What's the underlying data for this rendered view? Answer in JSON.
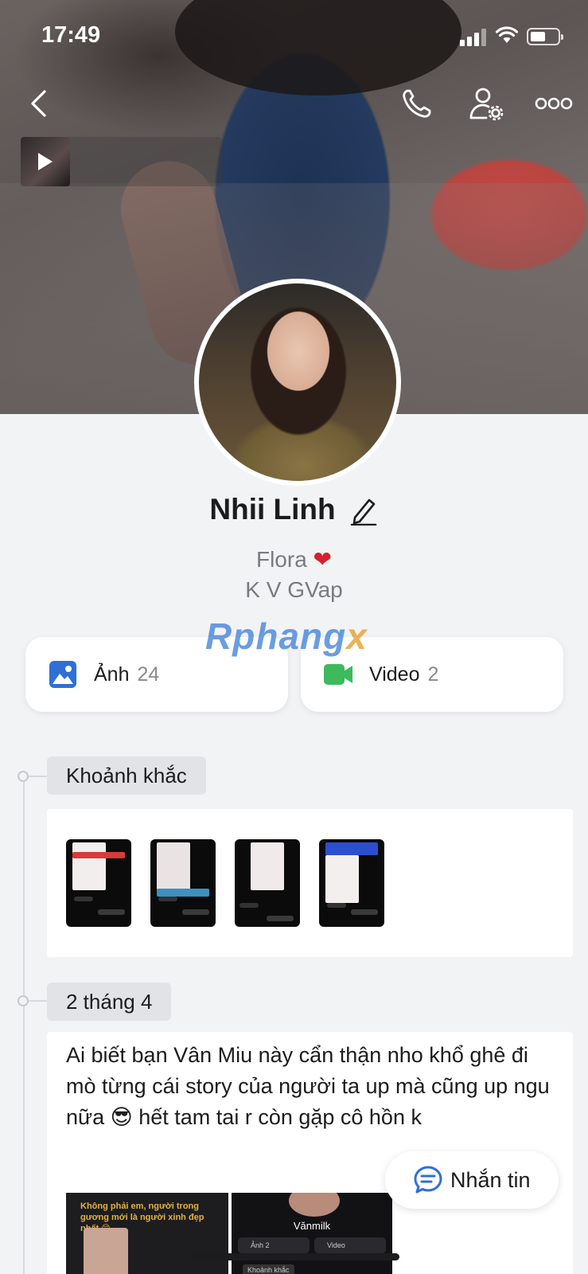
{
  "status_bar": {
    "time": "17:49"
  },
  "profile": {
    "name": "Nhii Linh",
    "bio_line1": "Flora",
    "bio_heart": "❤",
    "bio_line2": "K V GVap"
  },
  "watermark": {
    "main": "Rphang",
    "accent": "x"
  },
  "media": {
    "photos_label": "Ảnh",
    "photos_count": "24",
    "videos_label": "Video",
    "videos_count": "2"
  },
  "timeline": {
    "moments_label": "Khoảnh khắc",
    "date_label": "2 tháng 4",
    "post_text": "Ai biết bạn Vân Miu này cẩn thận nho khổ ghê đi mò từng cái story của người ta up mà cũng up ngu nữa 😎 hết tam tai r còn gặp cô hồn k",
    "post_image_caption": "Không phải em, người trong gương mới là người xinh đẹp nhất 😊",
    "post_image_name": "Vănmilk",
    "post_image_photos": "Ảnh 2",
    "post_image_video": "Video",
    "post_image_moments": "Khoảnh khắc"
  },
  "message_button": {
    "label": "Nhắn tin"
  },
  "colors": {
    "accent": "#2f6fd6",
    "video": "#3cba5c",
    "heart": "#d4222e"
  }
}
